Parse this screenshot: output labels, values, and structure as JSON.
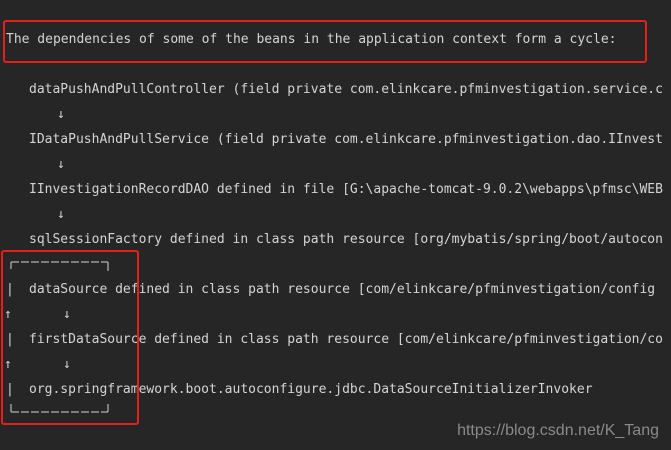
{
  "console": {
    "header": "The dependencies of some of the beans in the application context form a cycle:",
    "chain": [
      "dataPushAndPullController (field private com.elinkcare.pfminvestigation.service.c",
      "IDataPushAndPullService (field private com.elinkcare.pfminvestigation.dao.IInvest",
      "IInvestigationRecordDAO defined in file [G:\\apache-tomcat-9.0.2\\webapps\\pfmsc\\WEB",
      "sqlSessionFactory defined in class path resource [org/mybatis/spring/boot/autocon"
    ],
    "cycle": [
      "dataSource defined in class path resource [com/elinkcare/pfminvestigation/config",
      "firstDataSource defined in class path resource [com/elinkcare/pfminvestigation/co",
      "org.springframework.boot.autoconfigure.jdbc.DataSourceInitializerInvoker"
    ],
    "arrow_glyph": "↓",
    "up_glyph": "↑",
    "bar_glyph": "|"
  },
  "watermark": "https://blog.csdn.net/K_Tang",
  "colors": {
    "background": "#262626",
    "text": "#d4d4d4",
    "highlight": "#e5201c",
    "watermark": "#8a8a8a"
  }
}
